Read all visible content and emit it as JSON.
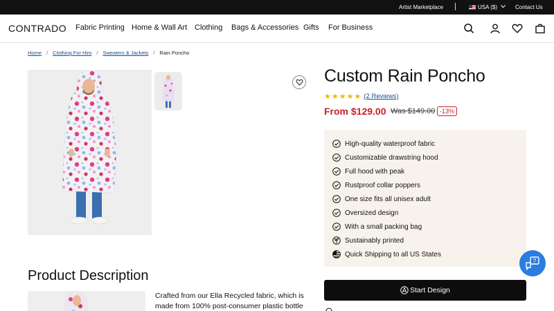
{
  "topbar": {
    "artist_marketplace": "Artist Marketplace",
    "region": "USA ($)",
    "contact": "Contact Us"
  },
  "nav": {
    "logo": "CONTRADO",
    "links": [
      "Fabric Printing",
      "Home & Wall Art",
      "Clothing",
      "Bags & Accessories",
      "Gifts",
      "For Business"
    ],
    "icons": [
      "search-icon",
      "account-icon",
      "heart-icon",
      "bag-icon"
    ]
  },
  "breadcrumb": {
    "items": [
      "Home",
      "Clothing For Him",
      "Sweaters & Jackets"
    ],
    "current": "Rain Poncho"
  },
  "product": {
    "title": "Custom Rain Poncho",
    "rating_stars": 5,
    "reviews": "(2 Reviews)",
    "price": "From $129.00",
    "was_price": "Was $149.00",
    "discount": "-13%",
    "features": [
      {
        "icon": "check-circle-icon",
        "text": "High-quality waterproof fabric"
      },
      {
        "icon": "check-circle-icon",
        "text": "Customizable drawstring hood"
      },
      {
        "icon": "check-circle-icon",
        "text": "Full hood with peak"
      },
      {
        "icon": "check-circle-icon",
        "text": "Rustproof collar poppers"
      },
      {
        "icon": "check-circle-icon",
        "text": "One size fits all unisex adult"
      },
      {
        "icon": "check-circle-icon",
        "text": "Oversized design"
      },
      {
        "icon": "check-circle-icon",
        "text": "With a small packing bag"
      },
      {
        "icon": "leaf-icon",
        "text": "Sustainably printed"
      },
      {
        "icon": "us-flag-icon",
        "text": "Quick Shipping to all US States"
      }
    ],
    "cta": "Start Design"
  },
  "description": {
    "heading": "Product Description",
    "text": "Crafted from our Ella Recycled fabric, which is made from 100% post-consumer plastic bottle"
  },
  "colors": {
    "accent_red": "#c8212b",
    "link_blue": "#1a4c8a",
    "feature_bg": "#f7f3ec",
    "chat_blue": "#2a7de1"
  }
}
